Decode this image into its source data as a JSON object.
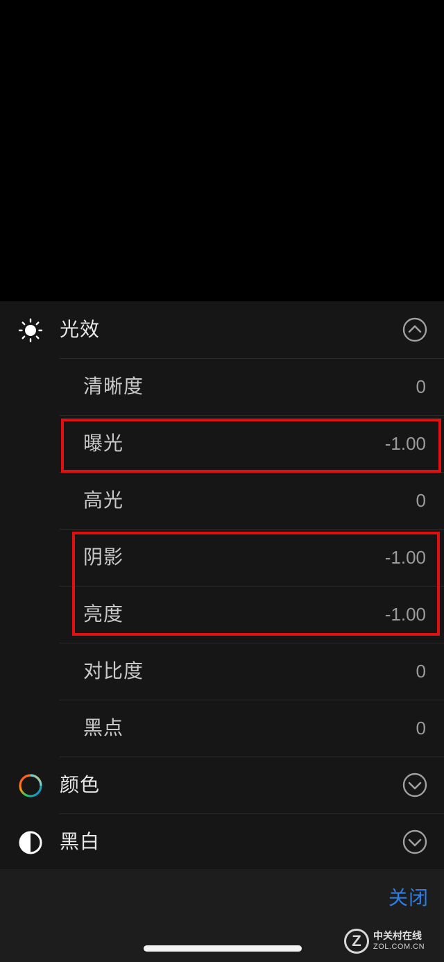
{
  "lighting": {
    "title": "光效",
    "icon": "sun-icon",
    "expanded": true,
    "rows": [
      {
        "label": "清晰度",
        "value": "0"
      },
      {
        "label": "曝光",
        "value": "-1.00"
      },
      {
        "label": "高光",
        "value": "0"
      },
      {
        "label": "阴影",
        "value": "-1.00"
      },
      {
        "label": "亮度",
        "value": "-1.00"
      },
      {
        "label": "对比度",
        "value": "0"
      },
      {
        "label": "黑点",
        "value": "0"
      }
    ]
  },
  "color": {
    "title": "颜色",
    "icon": "color-wheel-icon",
    "expanded": false
  },
  "black_white": {
    "title": "黑白",
    "icon": "half-circle-icon",
    "expanded": false
  },
  "toolbar": {
    "close_label": "关闭"
  },
  "watermark": {
    "cn": "中关村在线",
    "en": "ZOL.COM.CN",
    "logo": "Z"
  },
  "colors": {
    "accent": "#2f7de1",
    "highlight": "#e01010",
    "panel": "#161616"
  }
}
